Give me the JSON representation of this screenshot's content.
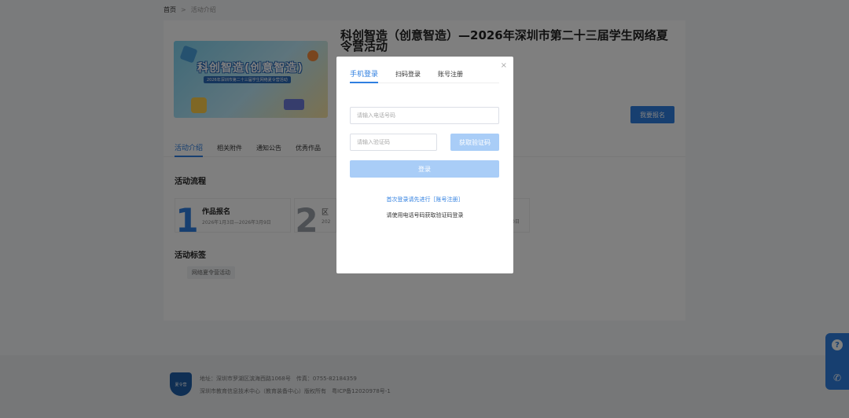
{
  "breadcrumb": {
    "home": "首页",
    "sep": ">",
    "current": "活动介绍"
  },
  "activity": {
    "title": "科创智造（创意智造）—2026年深圳市第二十三届学生网络夏令营活动",
    "banner_title": "科创智造(创意智造)",
    "banner_sub": "2026年深圳市第二十三届学生网络夏令营活动",
    "enroll_button": "我要报名"
  },
  "tabs": [
    "活动介绍",
    "相关附件",
    "通知公告",
    "优秀作品"
  ],
  "flow": {
    "title": "活动流程",
    "steps": [
      {
        "num": "1",
        "name": "作品报名",
        "date": "2026年1月3日—2026年3月9日"
      },
      {
        "num": "2",
        "name": "区",
        "date": "202"
      },
      {
        "num": "",
        "name": "",
        "date": "0日"
      }
    ]
  },
  "tags": {
    "title": "活动标签",
    "items": [
      "网络夏令营活动"
    ]
  },
  "footer": {
    "logo_text": "夏令营",
    "line1": "地址：深圳市罗湖区滨海西路1068号　传真：0755-82184359",
    "line2": "深圳市教育信息技术中心（教育装备中心）版权所有　粤ICP备12020978号-1"
  },
  "side": {
    "help": "?",
    "phone": "✆"
  },
  "modal": {
    "tabs": [
      "手机登录",
      "扫码登录",
      "账号注册"
    ],
    "close": "×",
    "phone_placeholder": "请输入电话号码",
    "code_placeholder": "请输入验证码",
    "get_code": "获取验证码",
    "login": "登录",
    "hint1": "首次登录请先进行［账号注册］",
    "hint2": "请使用电话号码获取验证码登录"
  },
  "colors": {
    "accent": "#2f7fe0",
    "disabled": "#a9cdf7"
  }
}
